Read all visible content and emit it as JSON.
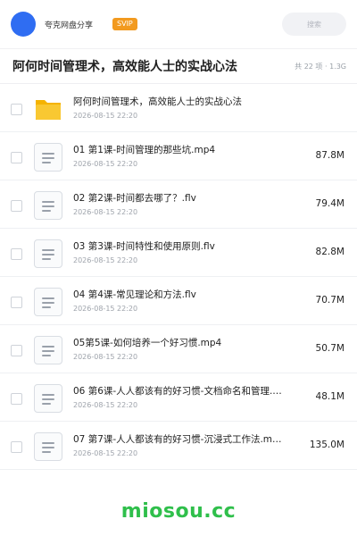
{
  "header": {
    "brand": "夸克网盘分享",
    "badge": "SVIP",
    "search_placeholder": "搜索"
  },
  "share": {
    "title": "阿何时间管理术，高效能人士的实战心法",
    "summary": "共 22 项 · 1.3G"
  },
  "files": [
    {
      "name": "阿何时间管理术，高效能人士的实战心法",
      "date": "2026-08-15 22:20",
      "size": "",
      "icon": "folder-icon"
    },
    {
      "name": "01 第1课-时间管理的那些坑.mp4",
      "date": "2026-08-15 22:20",
      "size": "87.8M",
      "icon": "file-icon"
    },
    {
      "name": "02 第2课-时间都去哪了？.flv",
      "date": "2026-08-15 22:20",
      "size": "79.4M",
      "icon": "file-icon"
    },
    {
      "name": "03 第3课-时间特性和使用原则.flv",
      "date": "2026-08-15 22:20",
      "size": "82.8M",
      "icon": "file-icon"
    },
    {
      "name": "04 第4课-常见理论和方法.flv",
      "date": "2026-08-15 22:20",
      "size": "70.7M",
      "icon": "file-icon"
    },
    {
      "name": "05第5课-如何培养一个好习惯.mp4",
      "date": "2026-08-15 22:20",
      "size": "50.7M",
      "icon": "file-icon"
    },
    {
      "name": "06 第6课-人人都该有的好习惯-文档命名和管理.…",
      "date": "2026-08-15 22:20",
      "size": "48.1M",
      "icon": "file-icon"
    },
    {
      "name": "07 第7课-人人都该有的好习惯-沉浸式工作法.m…",
      "date": "2026-08-15 22:20",
      "size": "135.0M",
      "icon": "file-icon"
    }
  ],
  "watermark": "miosou.cc",
  "colors": {
    "accent": "#2f6df2",
    "svip": "#f29a1f",
    "folder": "#f7c21d",
    "watermark": "#2fbf4b"
  }
}
